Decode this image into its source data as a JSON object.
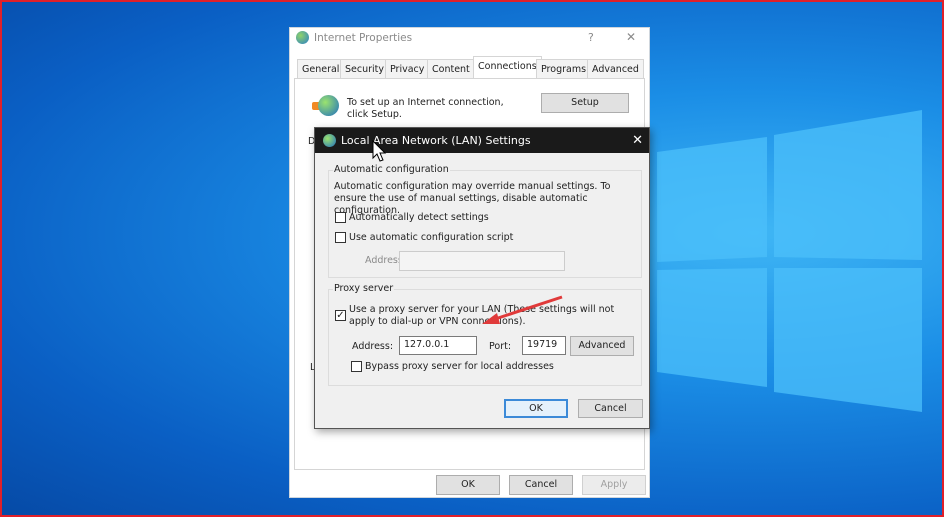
{
  "colors": {
    "accent": "#3c8ad8",
    "frame": "#e0202a",
    "arrow": "#e03a3a"
  },
  "main_window": {
    "title": "Internet Properties",
    "help": "?",
    "close": "✕",
    "tabs": [
      {
        "label": "General"
      },
      {
        "label": "Security"
      },
      {
        "label": "Privacy"
      },
      {
        "label": "Content"
      },
      {
        "label": "Connections"
      },
      {
        "label": "Programs"
      },
      {
        "label": "Advanced"
      }
    ],
    "setup_text": "To set up an Internet connection, click Setup.",
    "setup_button": "Setup",
    "partial_label_d": "D",
    "partial_label_l": "L",
    "ok": "OK",
    "cancel": "Cancel",
    "apply": "Apply"
  },
  "lan_dialog": {
    "title": "Local Area Network (LAN) Settings",
    "close": "✕",
    "auto_group": "Automatic configuration",
    "auto_desc": "Automatic configuration may override manual settings.  To ensure the use of manual settings, disable automatic configuration.",
    "auto_detect": {
      "label": "Automatically detect settings",
      "checked": false
    },
    "auto_script": {
      "label": "Use automatic configuration script",
      "checked": false
    },
    "script_address_label": "Address",
    "script_address_value": "",
    "proxy_group": "Proxy server",
    "use_proxy": {
      "label": "Use a proxy server for your LAN (These settings will not apply to dial-up or VPN connections).",
      "checked": true
    },
    "address_label": "Address:",
    "address_value": "127.0.0.1",
    "port_label": "Port:",
    "port_value": "19719",
    "advanced": "Advanced",
    "bypass": {
      "label": "Bypass proxy server for local addresses",
      "checked": false
    },
    "ok": "OK",
    "cancel": "Cancel"
  }
}
